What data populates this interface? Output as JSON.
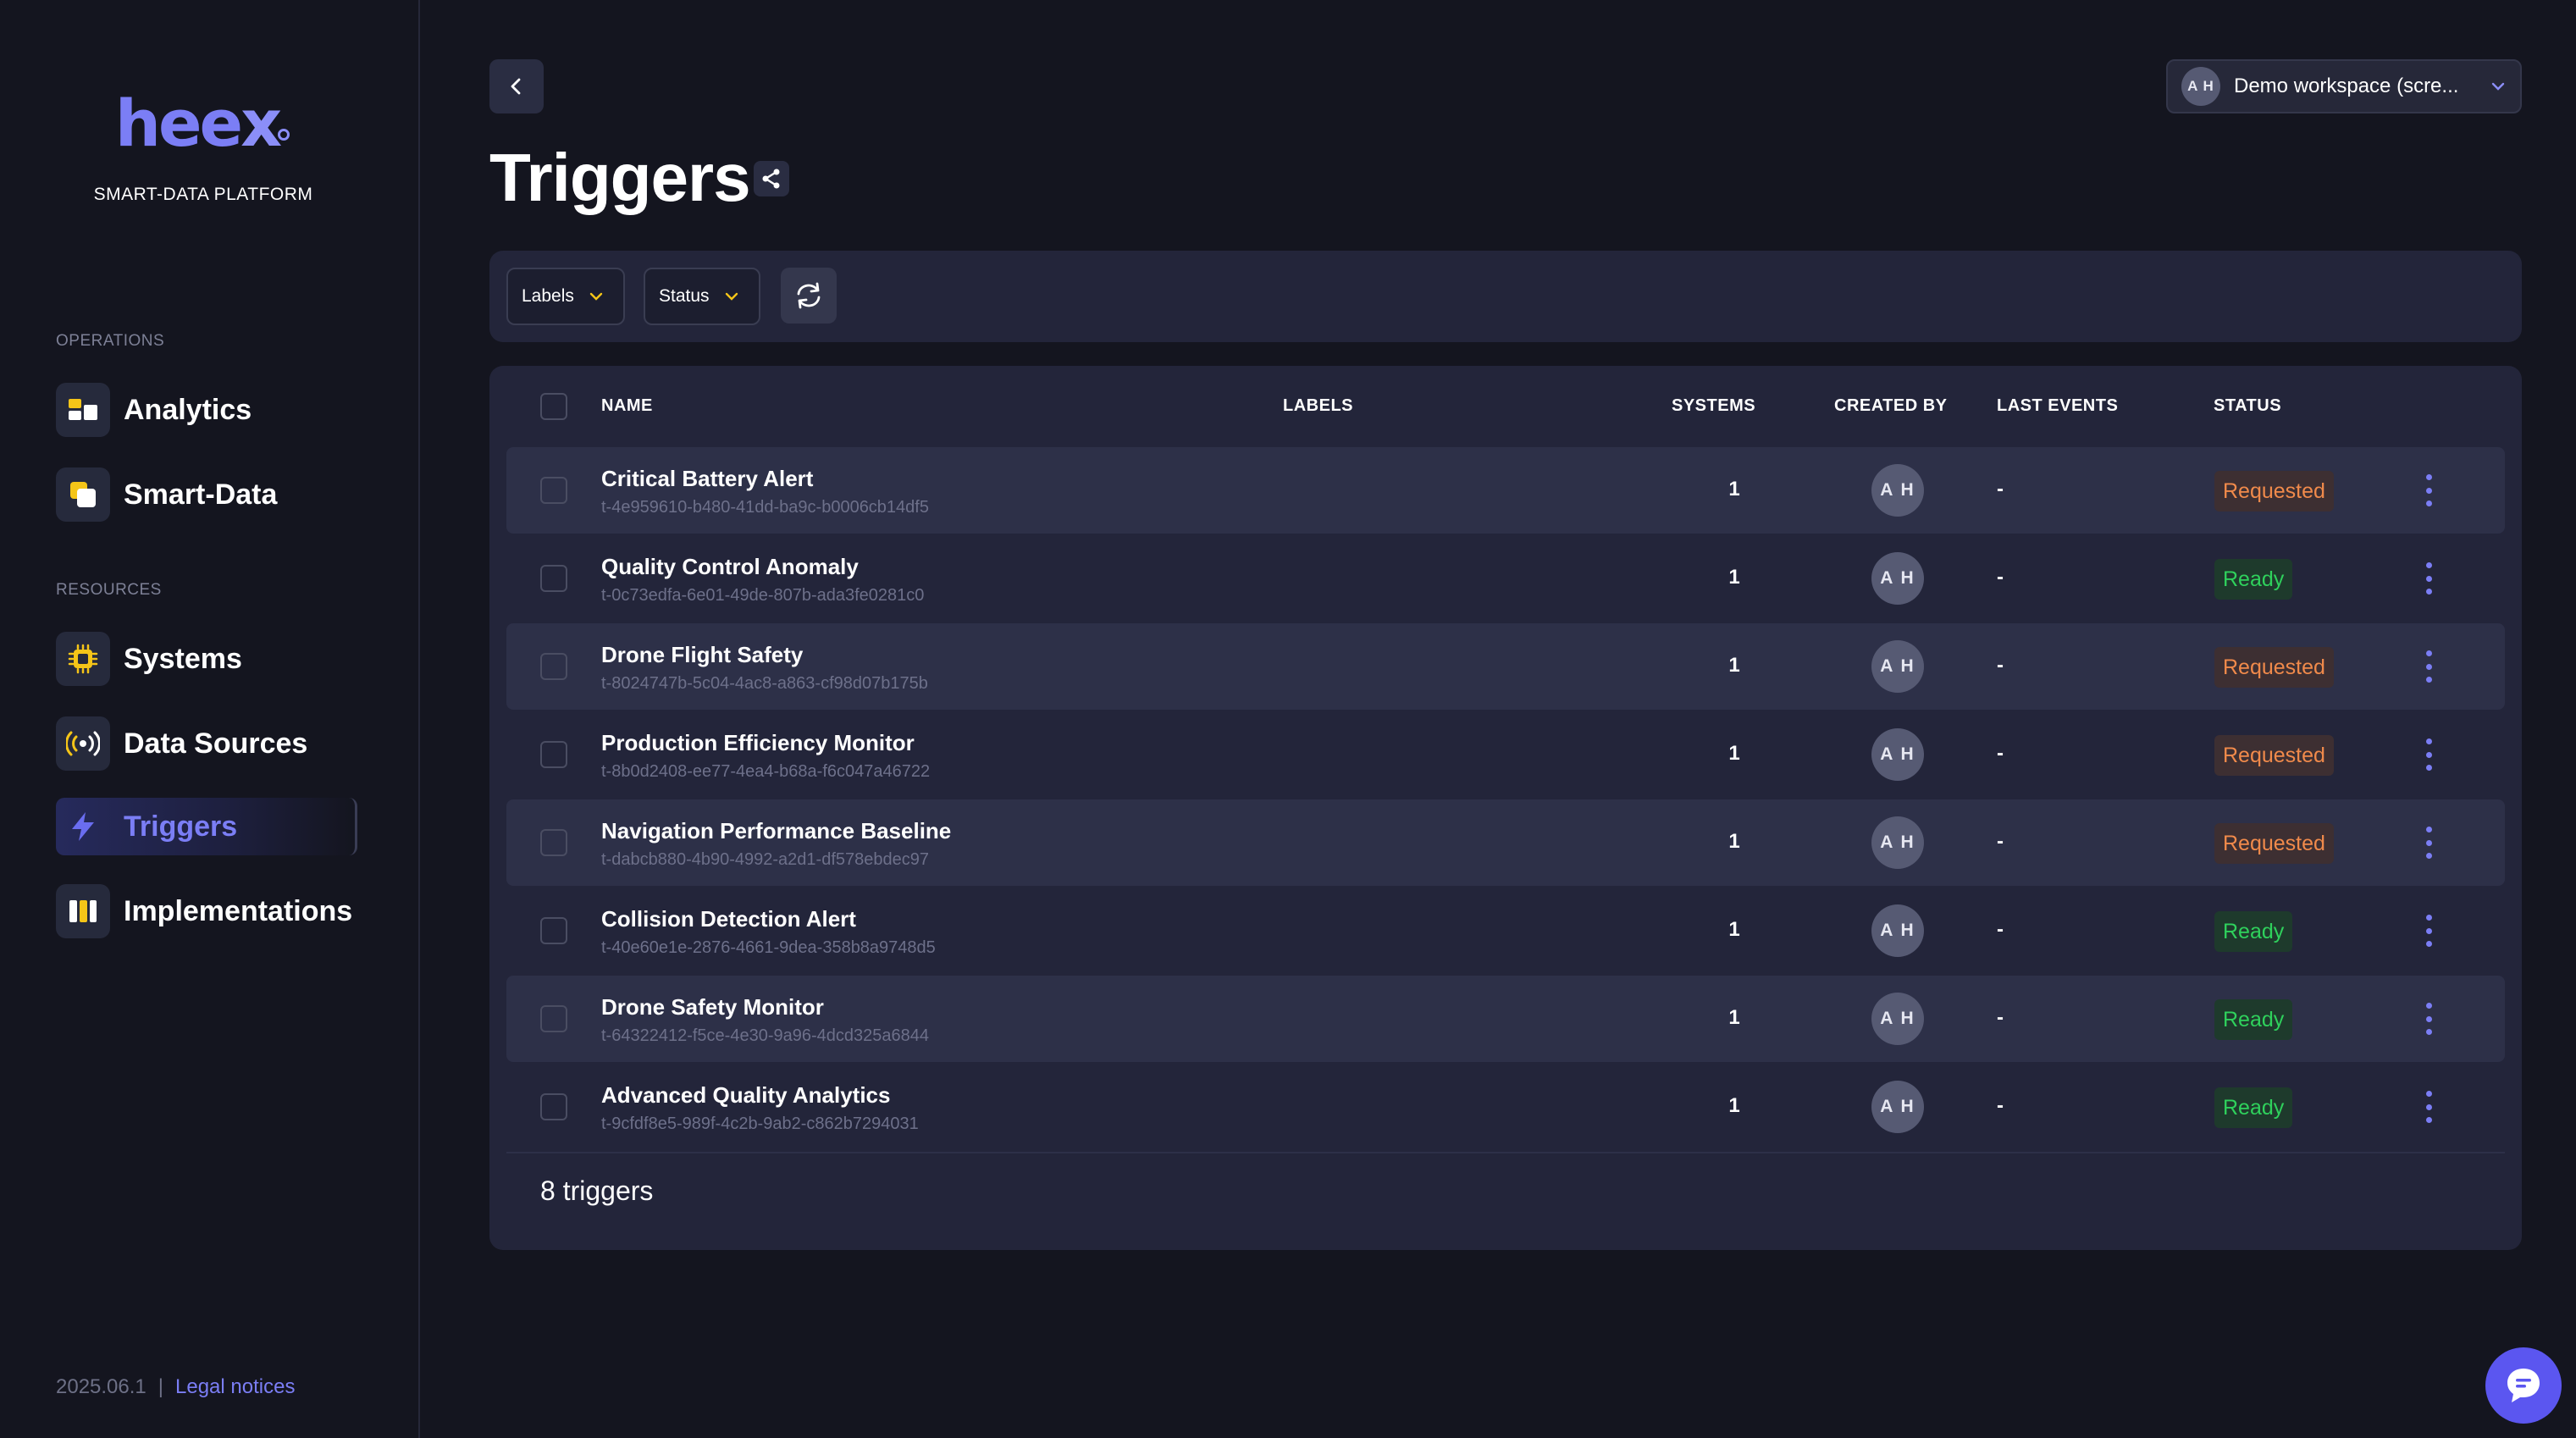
{
  "brand": {
    "logo_text": "heex",
    "tagline": "SMART-DATA PLATFORM"
  },
  "sidebar": {
    "sections": [
      {
        "label": "OPERATIONS"
      },
      {
        "label": "RESOURCES"
      }
    ],
    "items": [
      {
        "label": "Analytics",
        "icon": "analytics-icon",
        "active": false
      },
      {
        "label": "Smart-Data",
        "icon": "smart-data-icon",
        "active": false
      },
      {
        "label": "Systems",
        "icon": "chip-icon",
        "active": false
      },
      {
        "label": "Data Sources",
        "icon": "broadcast-icon",
        "active": false
      },
      {
        "label": "Triggers",
        "icon": "lightning-icon",
        "active": true
      },
      {
        "label": "Implementations",
        "icon": "columns-icon",
        "active": false
      }
    ],
    "footer": {
      "version": "2025.06.1",
      "separator": "|",
      "legal": "Legal notices"
    }
  },
  "header": {
    "title": "Triggers",
    "workspace": {
      "initials": "A H",
      "name": "Demo workspace (scre..."
    }
  },
  "filters": {
    "labels_label": "Labels",
    "status_label": "Status"
  },
  "table": {
    "columns": {
      "name": "NAME",
      "labels": "LABELS",
      "systems": "SYSTEMS",
      "created_by": "CREATED BY",
      "last_events": "LAST EVENTS",
      "status": "STATUS"
    },
    "rows": [
      {
        "name": "Critical Battery Alert",
        "id": "t-4e959610-b480-41dd-ba9c-b0006cb14df5",
        "systems": "1",
        "created_by": "A H",
        "last_events": "-",
        "status": "Requested"
      },
      {
        "name": "Quality Control Anomaly",
        "id": "t-0c73edfa-6e01-49de-807b-ada3fe0281c0",
        "systems": "1",
        "created_by": "A H",
        "last_events": "-",
        "status": "Ready"
      },
      {
        "name": "Drone Flight Safety",
        "id": "t-8024747b-5c04-4ac8-a863-cf98d07b175b",
        "systems": "1",
        "created_by": "A H",
        "last_events": "-",
        "status": "Requested"
      },
      {
        "name": "Production Efficiency Monitor",
        "id": "t-8b0d2408-ee77-4ea4-b68a-f6c047a46722",
        "systems": "1",
        "created_by": "A H",
        "last_events": "-",
        "status": "Requested"
      },
      {
        "name": "Navigation Performance Baseline",
        "id": "t-dabcb880-4b90-4992-a2d1-df578ebdec97",
        "systems": "1",
        "created_by": "A H",
        "last_events": "-",
        "status": "Requested"
      },
      {
        "name": "Collision Detection Alert",
        "id": "t-40e60e1e-2876-4661-9dea-358b8a9748d5",
        "systems": "1",
        "created_by": "A H",
        "last_events": "-",
        "status": "Ready"
      },
      {
        "name": "Drone Safety Monitor",
        "id": "t-64322412-f5ce-4e30-9a96-4dcd325a6844",
        "systems": "1",
        "created_by": "A H",
        "last_events": "-",
        "status": "Ready"
      },
      {
        "name": "Advanced Quality Analytics",
        "id": "t-9cfdf8e5-989f-4c2b-9ab2-c862b7294031",
        "systems": "1",
        "created_by": "A H",
        "last_events": "-",
        "status": "Ready"
      }
    ],
    "count_label": "8 triggers"
  },
  "colors": {
    "accent": "#7b7ef5",
    "requested": "#f08a4b",
    "ready": "#2fd15c",
    "background": "#14151f",
    "card": "#23253a"
  }
}
